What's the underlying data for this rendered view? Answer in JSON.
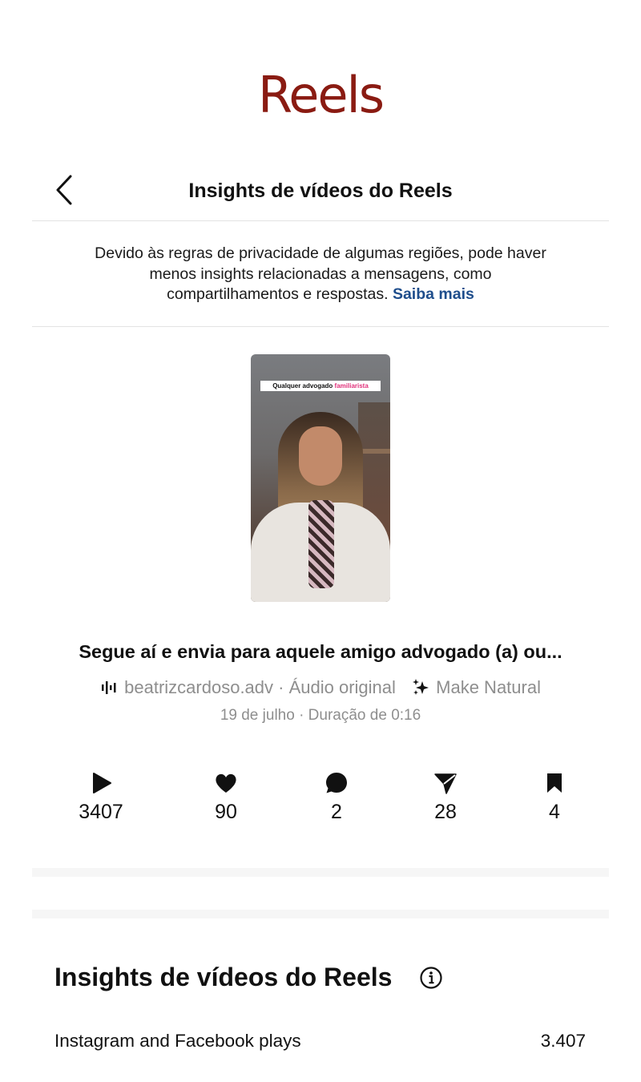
{
  "document": {
    "title": "Reels"
  },
  "header": {
    "title": "Insights de vídeos do Reels"
  },
  "notice": {
    "text": "Devido às regras de privacidade de algumas regiões, pode haver menos insights relacionadas a mensagens, como compartilhamentos e respostas.",
    "link": "Saiba mais"
  },
  "thumbnail": {
    "caption_text": "Qualquer advogado",
    "caption_highlight": "familiarista",
    "highlight_color": "#e0317a"
  },
  "reel": {
    "title": "Segue aí e envia para aquele amigo advogado (a) ou...",
    "audio": "beatrizcardoso.adv · Áudio original",
    "effect": "Make Natural",
    "date": "19 de julho · Duração de 0:16"
  },
  "stats": [
    {
      "icon": "play-icon",
      "value": "3407"
    },
    {
      "icon": "heart-icon",
      "value": "90"
    },
    {
      "icon": "comment-icon",
      "value": "2"
    },
    {
      "icon": "send-icon",
      "value": "28"
    },
    {
      "icon": "bookmark-icon",
      "value": "4"
    }
  ],
  "insights": {
    "title": "Insights de vídeos do Reels",
    "rows": [
      {
        "label": "Instagram and Facebook plays",
        "value": "3.407"
      }
    ]
  },
  "colors": {
    "title_red": "#8a1b12",
    "link_blue": "#1f4e8c",
    "muted_gray": "#8e8e8e"
  }
}
